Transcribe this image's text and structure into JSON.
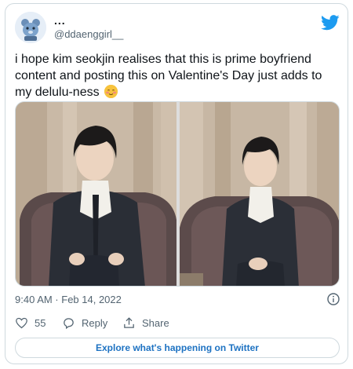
{
  "author": {
    "display_name": "...",
    "handle": "@ddaenggirl__",
    "avatar_icon": "bear-avatar-icon"
  },
  "tweet": {
    "text": "i hope kim seokjin realises that this is prime boyfriend content and posting this on Valentine's Day just adds to my delulu-ness",
    "emoji": "smiling-blushing-face-emoji"
  },
  "meta": {
    "timestamp": "9:40 AM · Feb 14, 2022"
  },
  "actions": {
    "likes": "55",
    "reply_label": "Reply",
    "share_label": "Share"
  },
  "explore_label": "Explore what's happening on Twitter",
  "colors": {
    "brand": "#1d9bf0",
    "link": "#1d72c2",
    "muted": "#536471"
  }
}
